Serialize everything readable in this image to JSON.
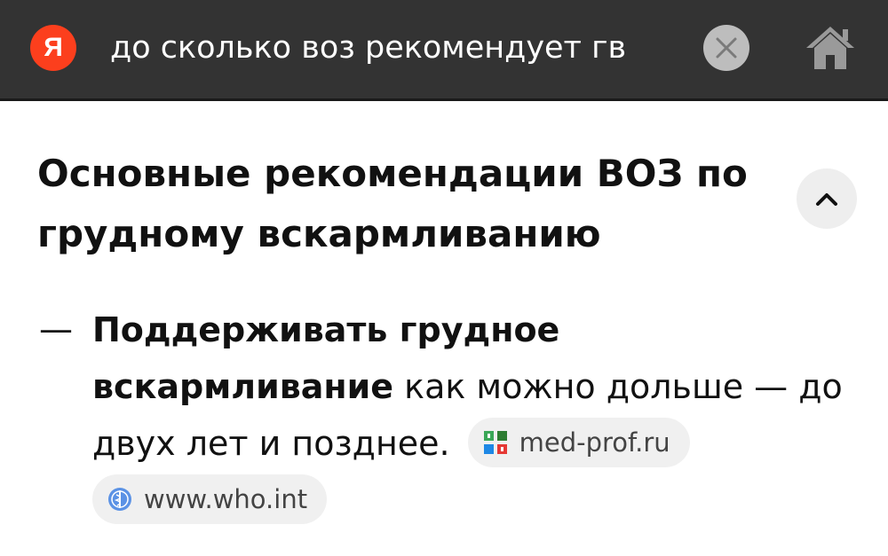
{
  "search": {
    "logo_letter": "Я",
    "query": "до сколько воз рекомендует гв"
  },
  "icons": {
    "logo": "yandex-logo-icon",
    "clear": "close-circle-icon",
    "home": "home-icon",
    "collapse": "chevron-up-icon",
    "source1": "med-prof-favicon-icon",
    "source2": "who-favicon-icon"
  },
  "colors": {
    "topbar": "#333333",
    "logo": "#fc3f1d",
    "chip_bg": "#f0f0f0",
    "collapse_bg": "#eeeeee"
  },
  "answer": {
    "heading": "Основные рекомендации ВОЗ по грудному вскармливанию",
    "dash": "—",
    "bold_text": "Поддерживать грудное вскармливание",
    "rest_text": " как можно дольше — до двух лет и позднее.",
    "sources": [
      {
        "label": "med-prof.ru"
      },
      {
        "label": "www.who.int"
      }
    ]
  }
}
